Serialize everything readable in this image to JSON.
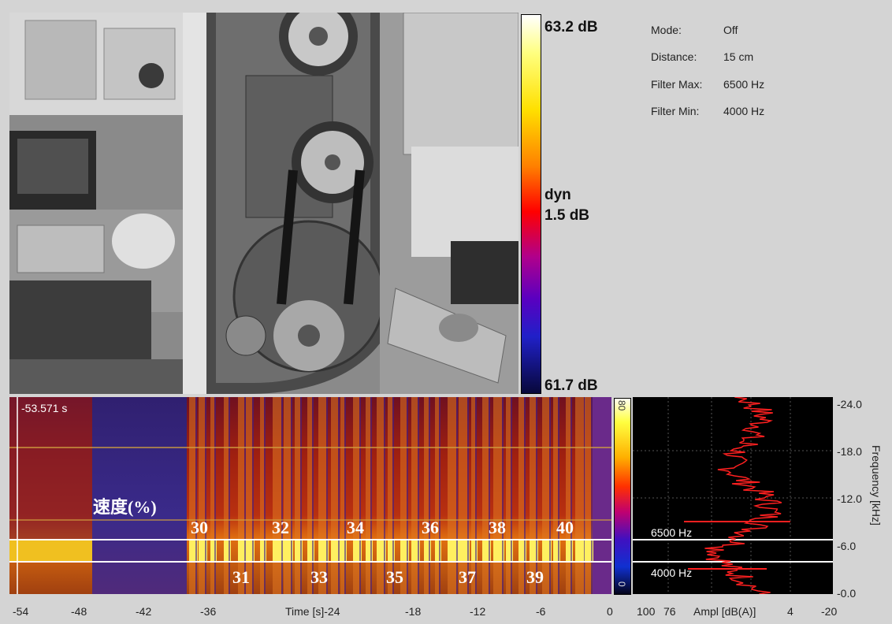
{
  "colorbar": {
    "max_label": "63.2 dB",
    "dyn_label": "dyn",
    "dyn_value": "1.5 dB",
    "min_label": "61.7 dB"
  },
  "info": {
    "mode_label": "Mode:",
    "mode_value": "Off",
    "distance_label": "Distance:",
    "distance_value": "15 cm",
    "filter_max_label": "Filter Max:",
    "filter_max_value": "6500 Hz",
    "filter_min_label": "Filter Min:",
    "filter_min_value": "4000 Hz"
  },
  "spectrogram": {
    "time_readout": "-53.571 s",
    "speed_title": "速度(%)",
    "speeds_upper": [
      "30",
      "32",
      "34",
      "36",
      "38",
      "40"
    ],
    "speeds_lower": [
      "31",
      "33",
      "35",
      "37",
      "39"
    ]
  },
  "spec_colorbar": {
    "top": "80",
    "bottom": "0"
  },
  "time_axis": {
    "ticks": [
      "-54",
      "-48",
      "-42",
      "-36",
      "Time [s]-24",
      "-18",
      "-12",
      "-6",
      "0"
    ]
  },
  "amp_axis": {
    "ticks": [
      "100",
      "76",
      "Ampl [dB(A)]",
      "4",
      "-20"
    ]
  },
  "freq_axis": {
    "label": "Frequency [kHz]",
    "ticks": [
      "-24.0",
      "-18.0",
      "-12.0",
      "-6.0",
      "-0.0"
    ]
  },
  "filters": {
    "max_tag": "6500 Hz",
    "min_tag": "4000 Hz"
  },
  "colors": {
    "filter_line": "#ffffff",
    "amplitude_trace": "#ff2020",
    "panel_bg": "#d4d4d4"
  }
}
